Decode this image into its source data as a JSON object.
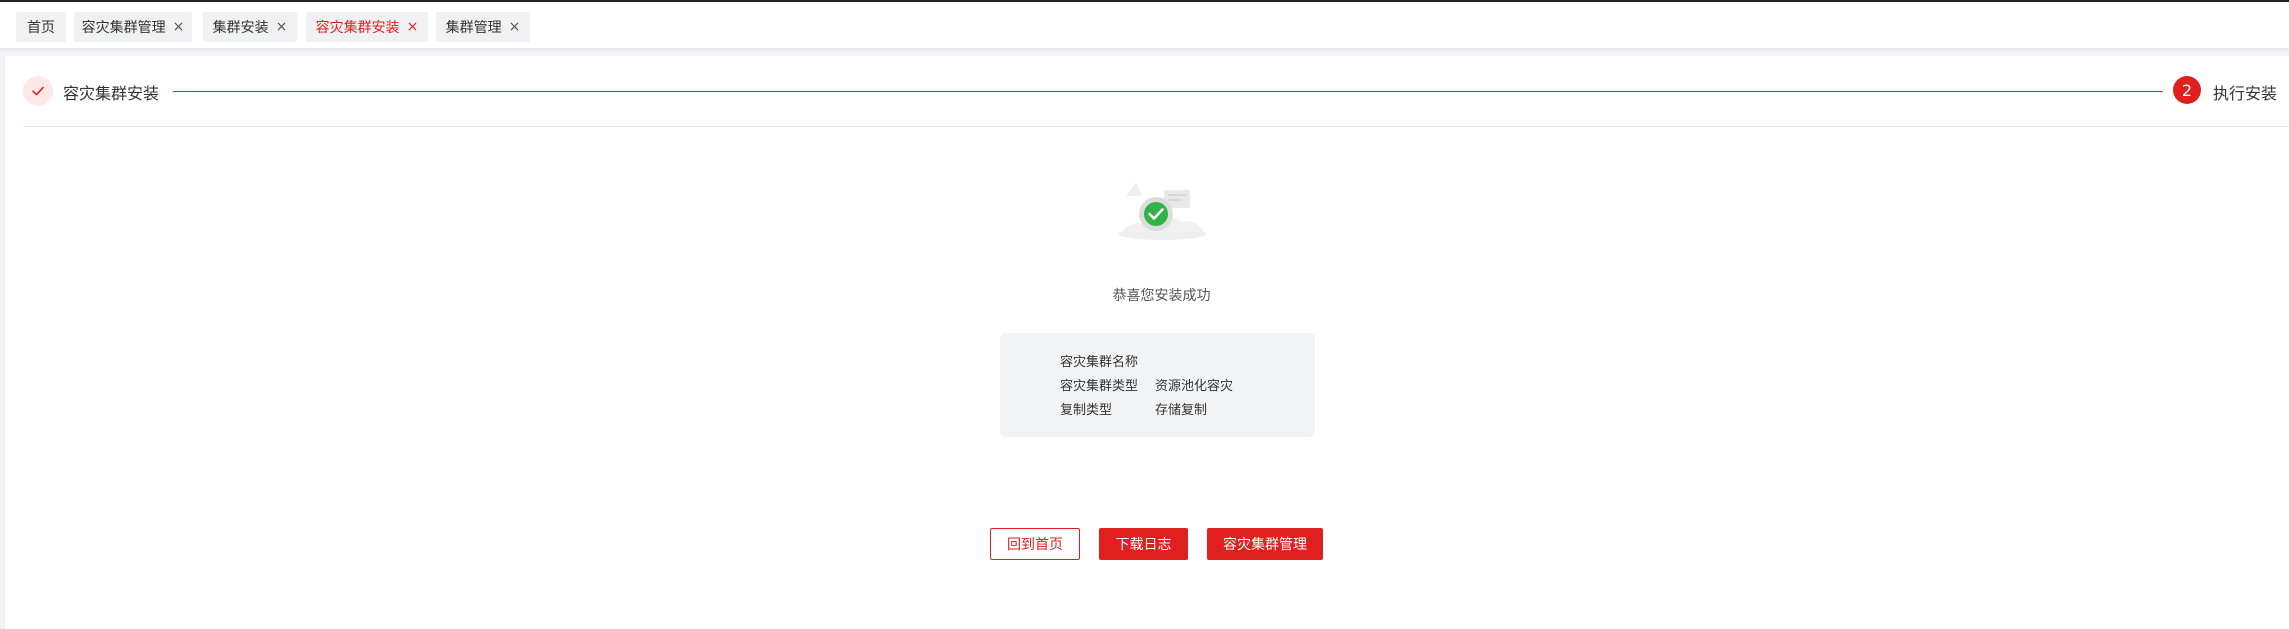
{
  "tabs": [
    {
      "label": "首页",
      "closable": false,
      "active": false
    },
    {
      "label": "容灾集群管理",
      "closable": true,
      "active": false
    },
    {
      "label": "集群安装",
      "closable": true,
      "active": false
    },
    {
      "label": "容灾集群安装",
      "closable": true,
      "active": true
    },
    {
      "label": "集群管理",
      "closable": true,
      "active": false
    }
  ],
  "tab_close_glyph": "×",
  "steps": {
    "step1_label": "容灾集群安装",
    "step2_number": "2",
    "step2_label": "执行安装"
  },
  "result": {
    "message": "恭喜您安装成功"
  },
  "info": {
    "rows": [
      {
        "key": "容灾集群名称",
        "value": ""
      },
      {
        "key": "容灾集群类型",
        "value": "资源池化容灾"
      },
      {
        "key": "复制类型",
        "value": "存储复制"
      }
    ]
  },
  "buttons": {
    "back_home": "回到首页",
    "download_log": "下载日志",
    "dr_cluster_manage": "容灾集群管理"
  },
  "colors": {
    "accent": "#e0201e",
    "success": "#2fb344"
  }
}
